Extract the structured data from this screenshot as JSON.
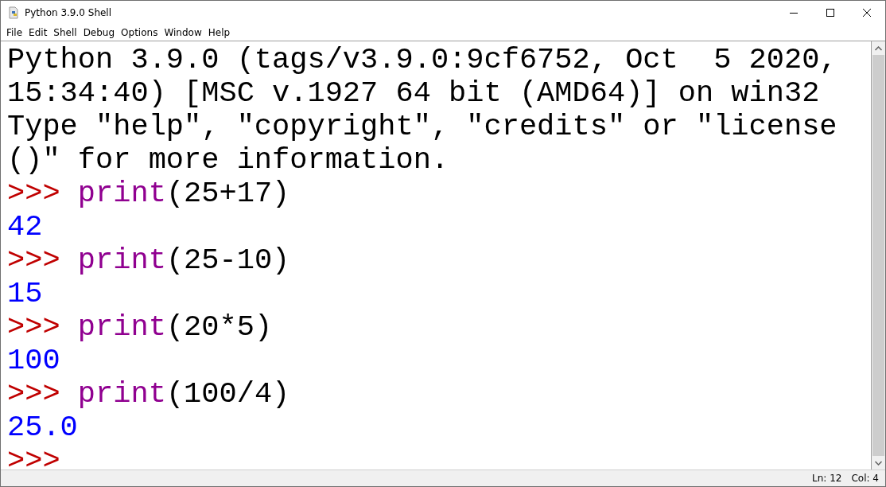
{
  "window": {
    "title": "Python 3.9.0 Shell"
  },
  "menu": [
    "File",
    "Edit",
    "Shell",
    "Debug",
    "Options",
    "Window",
    "Help"
  ],
  "lines": [
    {
      "kind": "banner",
      "text": "Python 3.9.0 (tags/v3.9.0:9cf6752, Oct  5 2020,"
    },
    {
      "kind": "banner",
      "text": "15:34:40) [MSC v.1927 64 bit (AMD64)] on win32"
    },
    {
      "kind": "banner",
      "text": "Type \"help\", \"copyright\", \"credits\" or \"license"
    },
    {
      "kind": "banner",
      "text": "()\" for more information."
    },
    {
      "kind": "input",
      "prompt": ">>>",
      "builtin": "print",
      "code": "(25+17)"
    },
    {
      "kind": "output",
      "text": "42"
    },
    {
      "kind": "input",
      "prompt": ">>>",
      "builtin": "print",
      "code": "(25-10)"
    },
    {
      "kind": "output",
      "text": "15"
    },
    {
      "kind": "input",
      "prompt": ">>>",
      "builtin": "print",
      "code": "(20*5)"
    },
    {
      "kind": "output",
      "text": "100"
    },
    {
      "kind": "input",
      "prompt": ">>>",
      "builtin": "print",
      "code": "(100/4)"
    },
    {
      "kind": "output",
      "text": "25.0"
    },
    {
      "kind": "input",
      "prompt": ">>>"
    }
  ],
  "status_bar": {
    "line": "Ln: 12",
    "column": "Col: 4"
  }
}
